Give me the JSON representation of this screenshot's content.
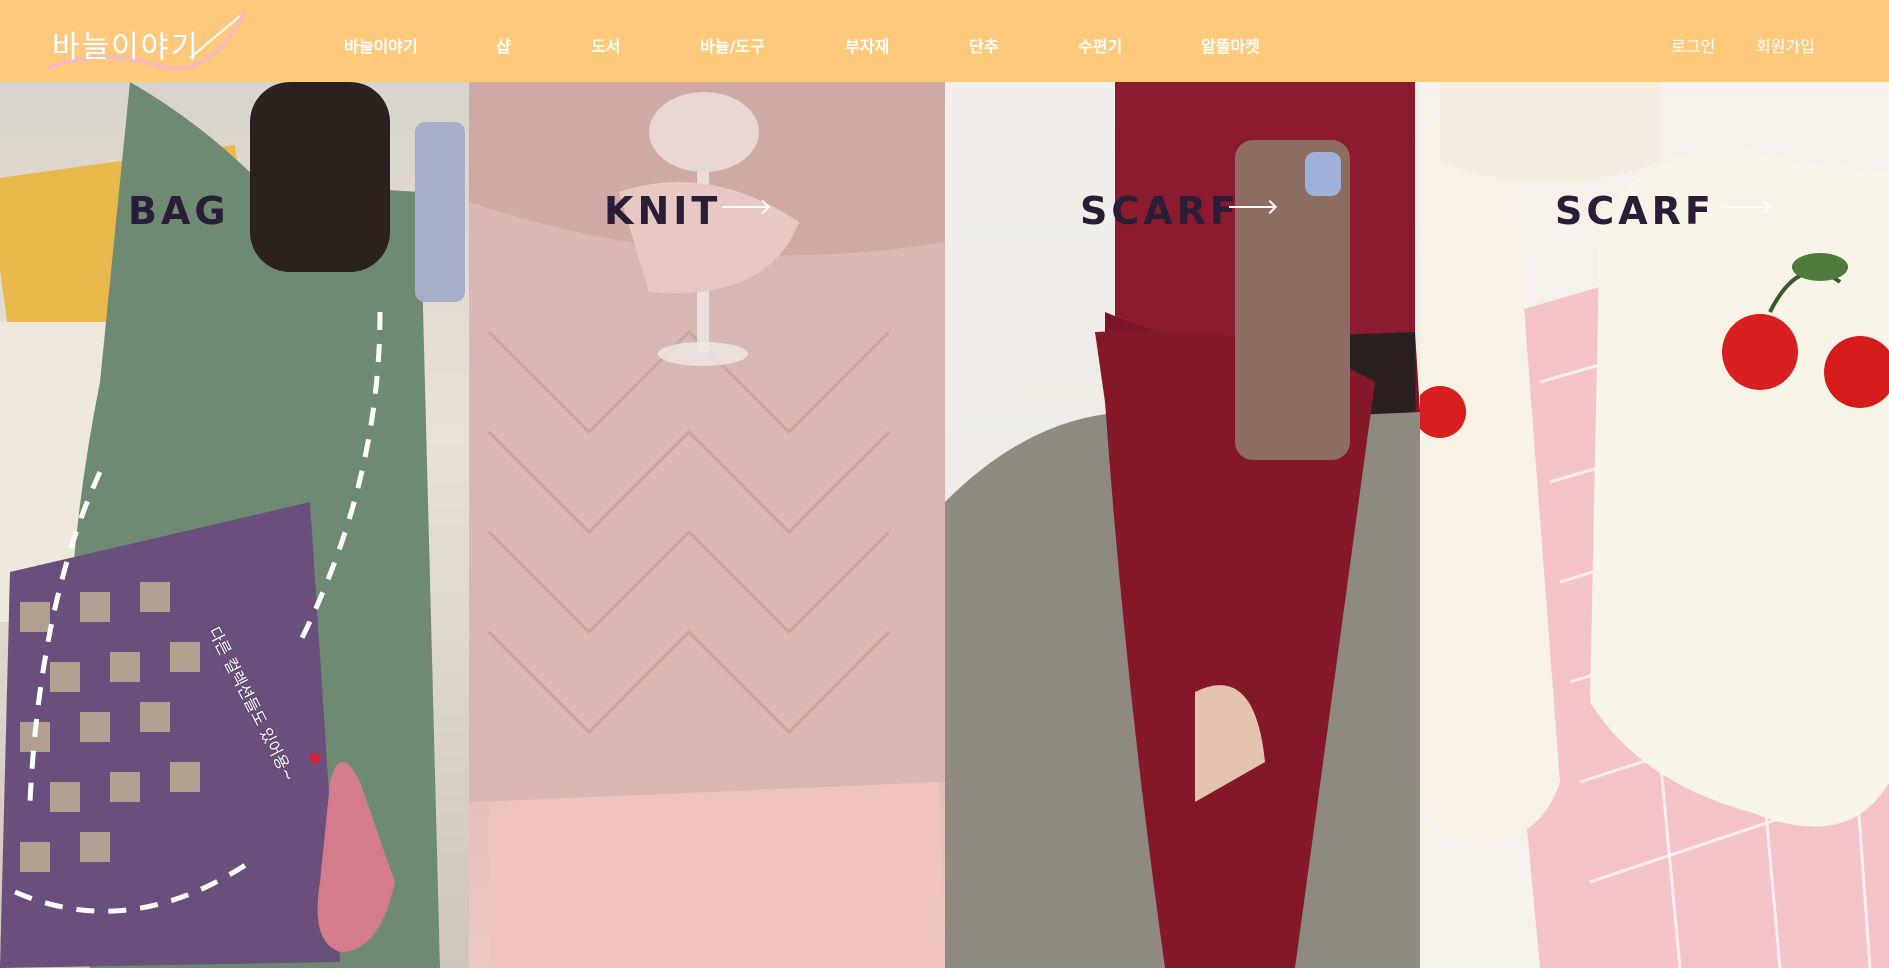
{
  "header": {
    "logo_text": "바늘이야기",
    "nav": [
      "바늘이야기",
      "샵",
      "도서",
      "바늘/도구",
      "부자재",
      "단추",
      "수편기",
      "알뜰마켓"
    ],
    "login": "로그인",
    "join": "회원가입"
  },
  "panels": [
    {
      "title": "bag",
      "note": "다른 컬렉션들도 있어용~"
    },
    {
      "title": "knit"
    },
    {
      "title": "scarf"
    },
    {
      "title": "scarf"
    }
  ],
  "colors": {
    "header_bg": "#fec97a",
    "title_color": "#2a1d38"
  }
}
